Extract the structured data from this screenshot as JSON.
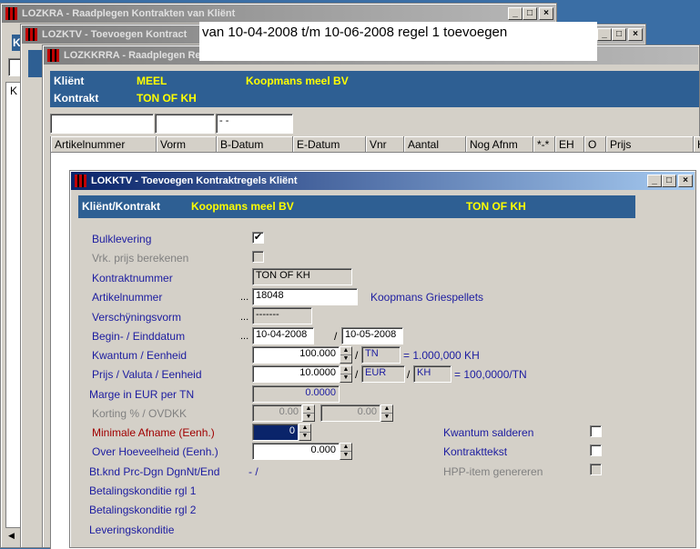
{
  "windows": {
    "lozkra": {
      "title": "LOZKRA - Raadplegen Kontrakten van Kliënt"
    },
    "lozktv": {
      "title": "LOZKTV - Toevoegen Kontract"
    },
    "lozkkrra": {
      "title": "LOZKKRRA - Raadplegen Re"
    },
    "lokktv": {
      "title": "LOKKTV - Toevoegen Kontraktregels Kliënt"
    }
  },
  "caption": "van 10-04-2008 t/m 10-06-2008  regel 1 toevoegen",
  "header": {
    "client_label": "Kliënt",
    "client_code": "MEEL",
    "client_name": "Koopmans meel BV",
    "contract_label": "Kontrakt",
    "contract_code": "TON OF KH"
  },
  "filter": {
    "date": "- -"
  },
  "grid_columns": [
    "Artikelnummer",
    "Vorm",
    "B-Datum",
    "E-Datum",
    "Vnr",
    "Aantal",
    "Nog Afnm",
    "*-*",
    "EH",
    "O",
    "Prijs",
    "H"
  ],
  "left_fragments": {
    "k1": "K",
    "k2": "K"
  },
  "dialog": {
    "bar": {
      "label": "Kliënt/Kontrakt",
      "client_name": "Koopmans meel BV",
      "contract_code": "TON OF KH"
    },
    "labels": {
      "bulk": "Bulklevering",
      "vrk": "Vrk. prijs berekenen",
      "contract_nr": "Kontraktnummer",
      "article_nr": "Artikelnummer",
      "form": "Verschÿningsvorm",
      "dates": "Begin- / Einddatum",
      "qty": "Kwantum / Eenheid",
      "price": "Prijs / Valuta / Eenheid",
      "margin": "Marge in EUR per TN",
      "discount": "Korting % / OVDKK",
      "min_afname": "Minimale Afname (Eenh.)",
      "over": "Over Hoeveelheid (Eenh.)",
      "btknd": "Bt.knd Prc-Dgn DgnNt/End",
      "betaling1": "Betalingskonditie rgl 1",
      "betaling2": "Betalingskonditie rgl 2",
      "levering": "Leveringskonditie",
      "kwantum_salderen": "Kwantum salderen",
      "kontrakttekst": "Kontrakttekst",
      "hpp": "HPP-item genereren"
    },
    "values": {
      "bulk_check": "✔",
      "contract_nr": "TON OF KH",
      "article_nr": "18048",
      "article_name": "Koopmans Griespellets",
      "form": "-------",
      "begin_date": "10-04-2008",
      "end_date": "10-05-2008",
      "date_sep": "/",
      "qty": "100.000",
      "qty_sep": "/",
      "qty_unit": "TN",
      "qty_conv": "= 1.000,000 KH",
      "price": "10.0000",
      "price_sep1": "/",
      "currency": "EUR",
      "price_sep2": "/",
      "price_unit": "KH",
      "price_conv": "= 100,0000/TN",
      "margin": "0.0000",
      "discount_pct": "0.00",
      "discount_ovdkk": "0.00",
      "min_afname": "0",
      "over": "0.000",
      "btknd": "- /",
      "dots": "..."
    }
  }
}
